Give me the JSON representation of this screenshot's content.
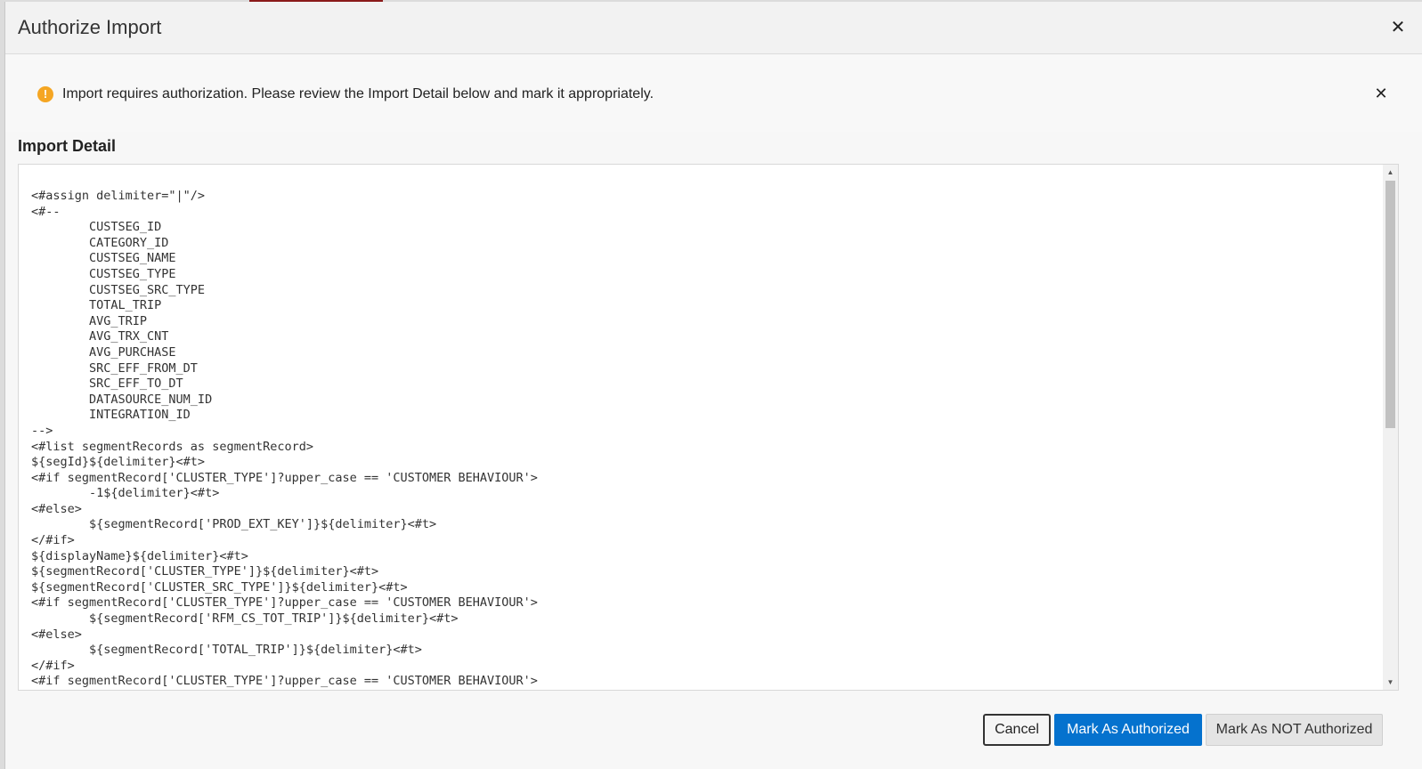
{
  "dialog": {
    "title": "Authorize Import",
    "close_glyph": "✕"
  },
  "message": {
    "icon": "warning-icon",
    "text": "Import requires authorization. Please review the Import Detail below and mark it appropriately.",
    "close_glyph": "✕"
  },
  "detail": {
    "label": "Import Detail",
    "code": "<#assign delimiter=\"|\"/>\n<#--\n        CUSTSEG_ID\n        CATEGORY_ID\n        CUSTSEG_NAME\n        CUSTSEG_TYPE\n        CUSTSEG_SRC_TYPE\n        TOTAL_TRIP\n        AVG_TRIP\n        AVG_TRX_CNT\n        AVG_PURCHASE\n        SRC_EFF_FROM_DT\n        SRC_EFF_TO_DT\n        DATASOURCE_NUM_ID\n        INTEGRATION_ID\n-->\n<#list segmentRecords as segmentRecord>\n${segId}${delimiter}<#t>\n<#if segmentRecord['CLUSTER_TYPE']?upper_case == 'CUSTOMER BEHAVIOUR'>\n        -1${delimiter}<#t>\n<#else>\n        ${segmentRecord['PROD_EXT_KEY']}${delimiter}<#t>\n</#if>\n${displayName}${delimiter}<#t>\n${segmentRecord['CLUSTER_TYPE']}${delimiter}<#t>\n${segmentRecord['CLUSTER_SRC_TYPE']}${delimiter}<#t>\n<#if segmentRecord['CLUSTER_TYPE']?upper_case == 'CUSTOMER BEHAVIOUR'>\n        ${segmentRecord['RFM_CS_TOT_TRIP']}${delimiter}<#t>\n<#else>\n        ${segmentRecord['TOTAL_TRIP']}${delimiter}<#t>\n</#if>\n<#if segmentRecord['CLUSTER_TYPE']?upper_case == 'CUSTOMER BEHAVIOUR'>"
  },
  "buttons": {
    "cancel": "Cancel",
    "mark_authorized": "Mark As Authorized",
    "mark_not_authorized": "Mark As NOT Authorized"
  },
  "colors": {
    "primary": "#0572ce",
    "warning": "#f5a623"
  }
}
